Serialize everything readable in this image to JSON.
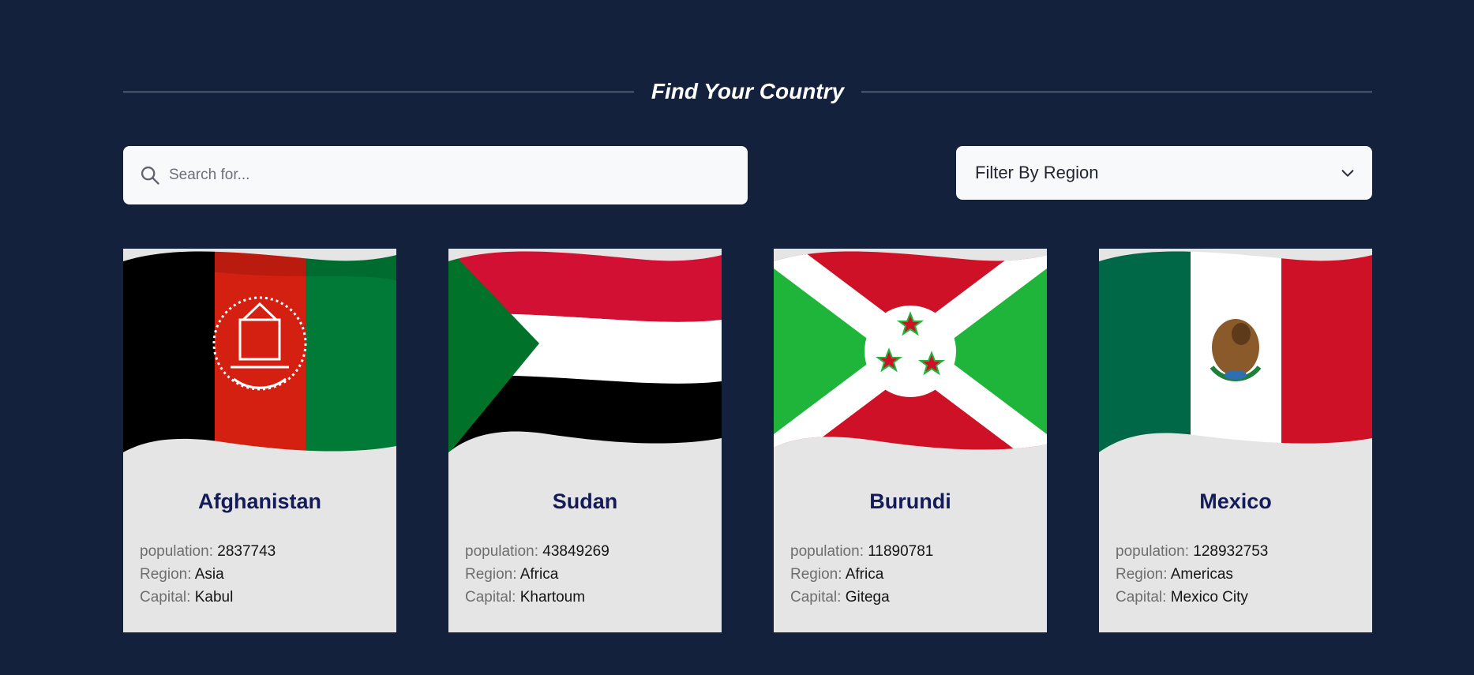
{
  "header": {
    "title": "Find Your Country"
  },
  "search": {
    "placeholder": "Search for...",
    "icon": "search-icon"
  },
  "filter": {
    "label": "Filter By Region",
    "icon": "chevron-down-icon"
  },
  "fact_labels": {
    "population": "population:",
    "region": "Region:",
    "capital": "Capital:"
  },
  "colors": {
    "background": "#14213d",
    "card": "#e5e5e5",
    "country_name": "#141b59"
  },
  "countries": [
    {
      "name": "Afghanistan",
      "population": "2837743",
      "region": "Asia",
      "capital": "Kabul",
      "flag_icon": "afghanistan-flag"
    },
    {
      "name": "Sudan",
      "population": "43849269",
      "region": "Africa",
      "capital": "Khartoum",
      "flag_icon": "sudan-flag"
    },
    {
      "name": "Burundi",
      "population": "11890781",
      "region": "Africa",
      "capital": "Gitega",
      "flag_icon": "burundi-flag"
    },
    {
      "name": "Mexico",
      "population": "128932753",
      "region": "Americas",
      "capital": "Mexico City",
      "flag_icon": "mexico-flag"
    }
  ]
}
